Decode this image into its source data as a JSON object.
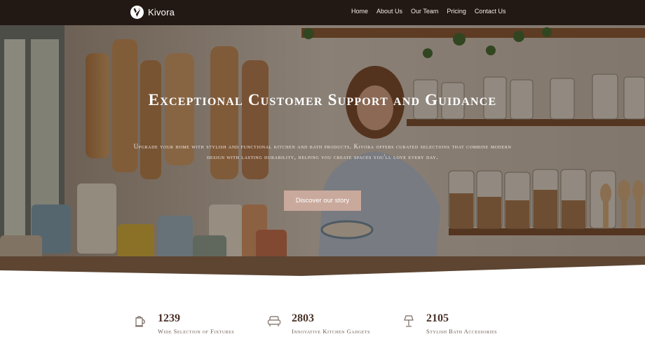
{
  "brand": {
    "name": "Kivora",
    "logo_icon": "kivora-logo-icon"
  },
  "nav": {
    "items": [
      {
        "label": "Home"
      },
      {
        "label": "About Us"
      },
      {
        "label": "Our Team"
      },
      {
        "label": "Pricing"
      },
      {
        "label": "Contact Us"
      }
    ]
  },
  "hero": {
    "title": "Exceptional Customer Support and Guidance",
    "subtitle": "Upgrade your home with stylish and functional kitchen and bath products. Kivora offers curated selections that combine modern design with lasting durability, helping you create spaces you'll love every day.",
    "cta_label": "Discover our story",
    "background": "kitchen-shelves-photo"
  },
  "stats": [
    {
      "icon": "kettle-icon",
      "value": "1239",
      "label": "Wide Selection of Fixtures"
    },
    {
      "icon": "sofa-icon",
      "value": "2803",
      "label": "Innovative Kitchen Gadgets"
    },
    {
      "icon": "lamp-icon",
      "value": "2105",
      "label": "Stylish Bath Accessories"
    }
  ],
  "colors": {
    "nav_bg": "#231914",
    "cta_bg": "#c9a99c",
    "stat_text": "#4a3128"
  }
}
